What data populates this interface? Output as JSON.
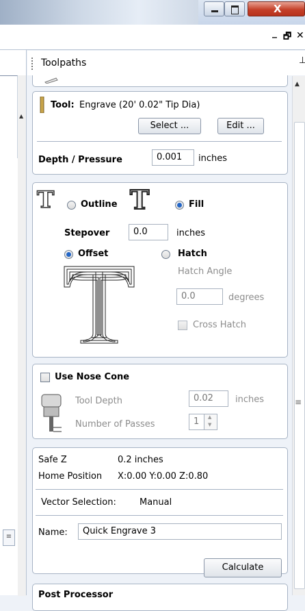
{
  "titlebar": {
    "close_glyph": "X"
  },
  "mdi": {
    "minimize": "_",
    "restore": "🗗",
    "close": "✕"
  },
  "panel": {
    "title": "Toolpaths",
    "pin_glyph": "⊥"
  },
  "tool": {
    "label": "Tool:",
    "value": "Engrave (20' 0.02\" Tip Dia)",
    "select_button": "Select ...",
    "edit_button": "Edit ..."
  },
  "depth": {
    "label": "Depth / Pressure",
    "value": "0.001",
    "unit": "inches"
  },
  "strategy": {
    "outline_label": "Outline",
    "fill_label": "Fill",
    "selected": "Fill",
    "stepover_label": "Stepover",
    "stepover_value": "0.0",
    "stepover_unit": "inches",
    "offset_label": "Offset",
    "hatch_label": "Hatch",
    "fill_type_selected": "Offset",
    "hatch_angle_label": "Hatch Angle",
    "hatch_angle_value": "0.0",
    "hatch_angle_unit": "degrees",
    "cross_hatch_label": "Cross Hatch"
  },
  "nose_cone": {
    "label": "Use Nose Cone",
    "checked": false,
    "tool_depth_label": "Tool Depth",
    "tool_depth_value": "0.02",
    "tool_depth_unit": "inches",
    "passes_label": "Number of Passes",
    "passes_value": "1"
  },
  "position": {
    "safe_z_label": "Safe Z",
    "safe_z_value": "0.2 inches",
    "home_label": "Home Position",
    "home_value": "X:0.00 Y:0.00 Z:0.80",
    "vector_label": "Vector Selection:",
    "vector_value": "Manual",
    "name_label": "Name:",
    "name_value": "Quick Engrave 3"
  },
  "calculate_button": "Calculate",
  "post_processor_label": "Post Processor",
  "colors": {
    "radio_selected": "#2366c7",
    "panel_border": "#a6b3c4",
    "background": "#eef2f8"
  }
}
